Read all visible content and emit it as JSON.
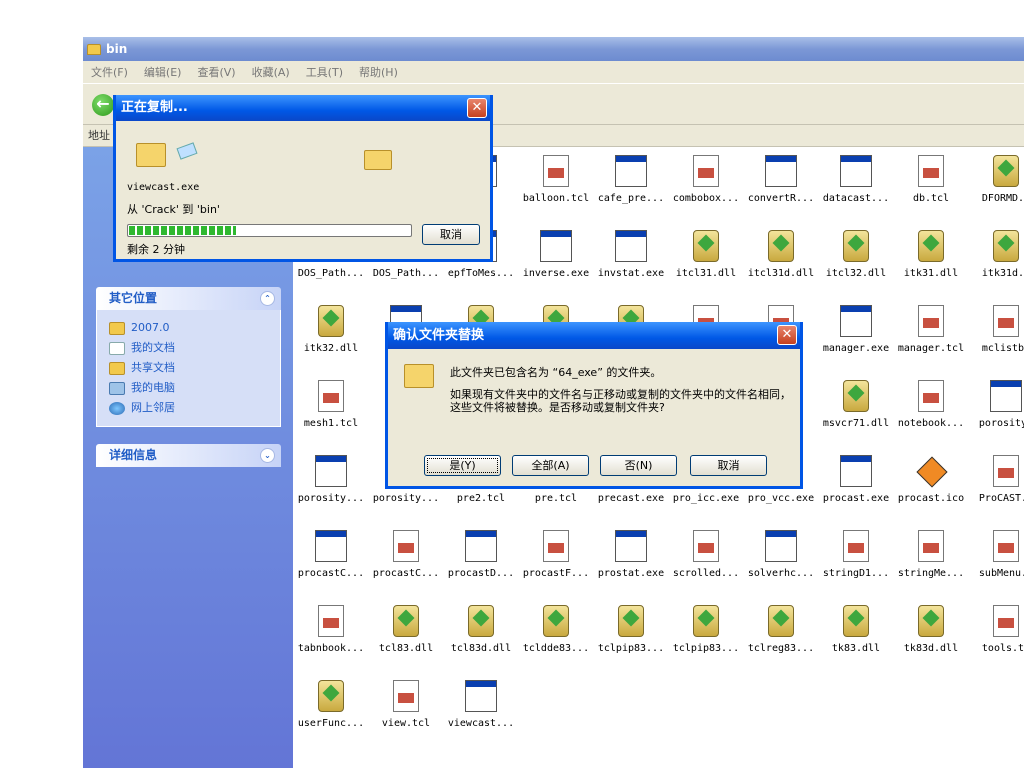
{
  "window": {
    "title": "bin"
  },
  "menu": [
    "文件(F)",
    "编辑(E)",
    "查看(V)",
    "收藏(A)",
    "工具(T)",
    "帮助(H)"
  ],
  "address_label": "地址",
  "sidebar": {
    "other_places": {
      "title": "其它位置",
      "items": [
        {
          "label": "2007.0",
          "icon": "folder-icon"
        },
        {
          "label": "我的文档",
          "icon": "documents-icon"
        },
        {
          "label": "共享文档",
          "icon": "folder-icon"
        },
        {
          "label": "我的电脑",
          "icon": "computer-icon"
        },
        {
          "label": "网上邻居",
          "icon": "network-icon"
        }
      ]
    },
    "details": {
      "title": "详细信息"
    }
  },
  "files": [
    {
      "name": "",
      "type": "app"
    },
    {
      "name": "",
      "type": "app"
    },
    {
      "name": "E",
      "type": "app"
    },
    {
      "name": "balloon.tcl",
      "type": "tcl"
    },
    {
      "name": "cafe_pre...",
      "type": "app"
    },
    {
      "name": "combobox...",
      "type": "tcl"
    },
    {
      "name": "convertR...",
      "type": "app"
    },
    {
      "name": "datacast...",
      "type": "app"
    },
    {
      "name": "db.tcl",
      "type": "tcl"
    },
    {
      "name": "DFORMD.D",
      "type": "dll"
    },
    {
      "name": "DOS_Path...",
      "type": "app"
    },
    {
      "name": "DOS_Path...",
      "type": "app"
    },
    {
      "name": "epfToMes...",
      "type": "app"
    },
    {
      "name": "inverse.exe",
      "type": "app"
    },
    {
      "name": "invstat.exe",
      "type": "app"
    },
    {
      "name": "itcl31.dll",
      "type": "dll"
    },
    {
      "name": "itcl31d.dll",
      "type": "dll"
    },
    {
      "name": "itcl32.dll",
      "type": "dll"
    },
    {
      "name": "itk31.dll",
      "type": "dll"
    },
    {
      "name": "itk31d.d",
      "type": "dll"
    },
    {
      "name": "itk32.dll",
      "type": "dll"
    },
    {
      "name": "la",
      "type": "app"
    },
    {
      "name": "",
      "type": "dll"
    },
    {
      "name": "",
      "type": "dll"
    },
    {
      "name": "",
      "type": "dll"
    },
    {
      "name": "",
      "type": "tcl"
    },
    {
      "name": "cl",
      "type": "tcl"
    },
    {
      "name": "manager.exe",
      "type": "app"
    },
    {
      "name": "manager.tcl",
      "type": "tcl"
    },
    {
      "name": "mclistbo",
      "type": "tcl"
    },
    {
      "name": "mesh1.tcl",
      "type": "tcl"
    },
    {
      "name": "m",
      "type": "app"
    },
    {
      "name": "",
      "type": "app"
    },
    {
      "name": "",
      "type": "app"
    },
    {
      "name": "",
      "type": "app"
    },
    {
      "name": "",
      "type": "app"
    },
    {
      "name": ".",
      "type": "app"
    },
    {
      "name": "msvcr71.dll",
      "type": "dll"
    },
    {
      "name": "notebook...",
      "type": "tcl"
    },
    {
      "name": "porosity.",
      "type": "app"
    },
    {
      "name": "porosity...",
      "type": "app"
    },
    {
      "name": "porosity...",
      "type": "app"
    },
    {
      "name": "pre2.tcl",
      "type": "tcl"
    },
    {
      "name": "pre.tcl",
      "type": "tcl"
    },
    {
      "name": "precast.exe",
      "type": "app"
    },
    {
      "name": "pro_icc.exe",
      "type": "app"
    },
    {
      "name": "pro_vcc.exe",
      "type": "app"
    },
    {
      "name": "procast.exe",
      "type": "app"
    },
    {
      "name": "procast.ico",
      "type": "ico"
    },
    {
      "name": "ProCAST.x",
      "type": "tcl"
    },
    {
      "name": "procastC...",
      "type": "app"
    },
    {
      "name": "procastC...",
      "type": "tcl"
    },
    {
      "name": "procastD...",
      "type": "app"
    },
    {
      "name": "procastF...",
      "type": "tcl"
    },
    {
      "name": "prostat.exe",
      "type": "app"
    },
    {
      "name": "scrolled...",
      "type": "tcl"
    },
    {
      "name": "solverhc...",
      "type": "app"
    },
    {
      "name": "stringD1...",
      "type": "tcl"
    },
    {
      "name": "stringMe...",
      "type": "tcl"
    },
    {
      "name": "subMenu.t",
      "type": "tcl"
    },
    {
      "name": "tabnbook...",
      "type": "tcl"
    },
    {
      "name": "tcl83.dll",
      "type": "dll"
    },
    {
      "name": "tcl83d.dll",
      "type": "dll"
    },
    {
      "name": "tcldde83...",
      "type": "dll"
    },
    {
      "name": "tclpip83...",
      "type": "dll"
    },
    {
      "name": "tclpip83...",
      "type": "dll"
    },
    {
      "name": "tclreg83...",
      "type": "dll"
    },
    {
      "name": "tk83.dll",
      "type": "dll"
    },
    {
      "name": "tk83d.dll",
      "type": "dll"
    },
    {
      "name": "tools.tc",
      "type": "tcl"
    },
    {
      "name": "userFunc...",
      "type": "dll"
    },
    {
      "name": "view.tcl",
      "type": "tcl"
    },
    {
      "name": "viewcast...",
      "type": "app"
    }
  ],
  "copy_dialog": {
    "title": "正在复制...",
    "file": "viewcast.exe",
    "from_to": "从 'Crack' 到 'bin'",
    "progress": 0.38,
    "remaining": "剩余 2 分钟",
    "cancel": "取消"
  },
  "confirm_dialog": {
    "title": "确认文件夹替换",
    "line1": "此文件夹已包含名为 “64_exe” 的文件夹。",
    "line2": "如果现有文件夹中的文件名与正移动或复制的文件夹中的文件名相同，这些文件将被替换。是否移动或复制文件夹?",
    "buttons": [
      "是(Y)",
      "全部(A)",
      "否(N)",
      "取消"
    ]
  }
}
